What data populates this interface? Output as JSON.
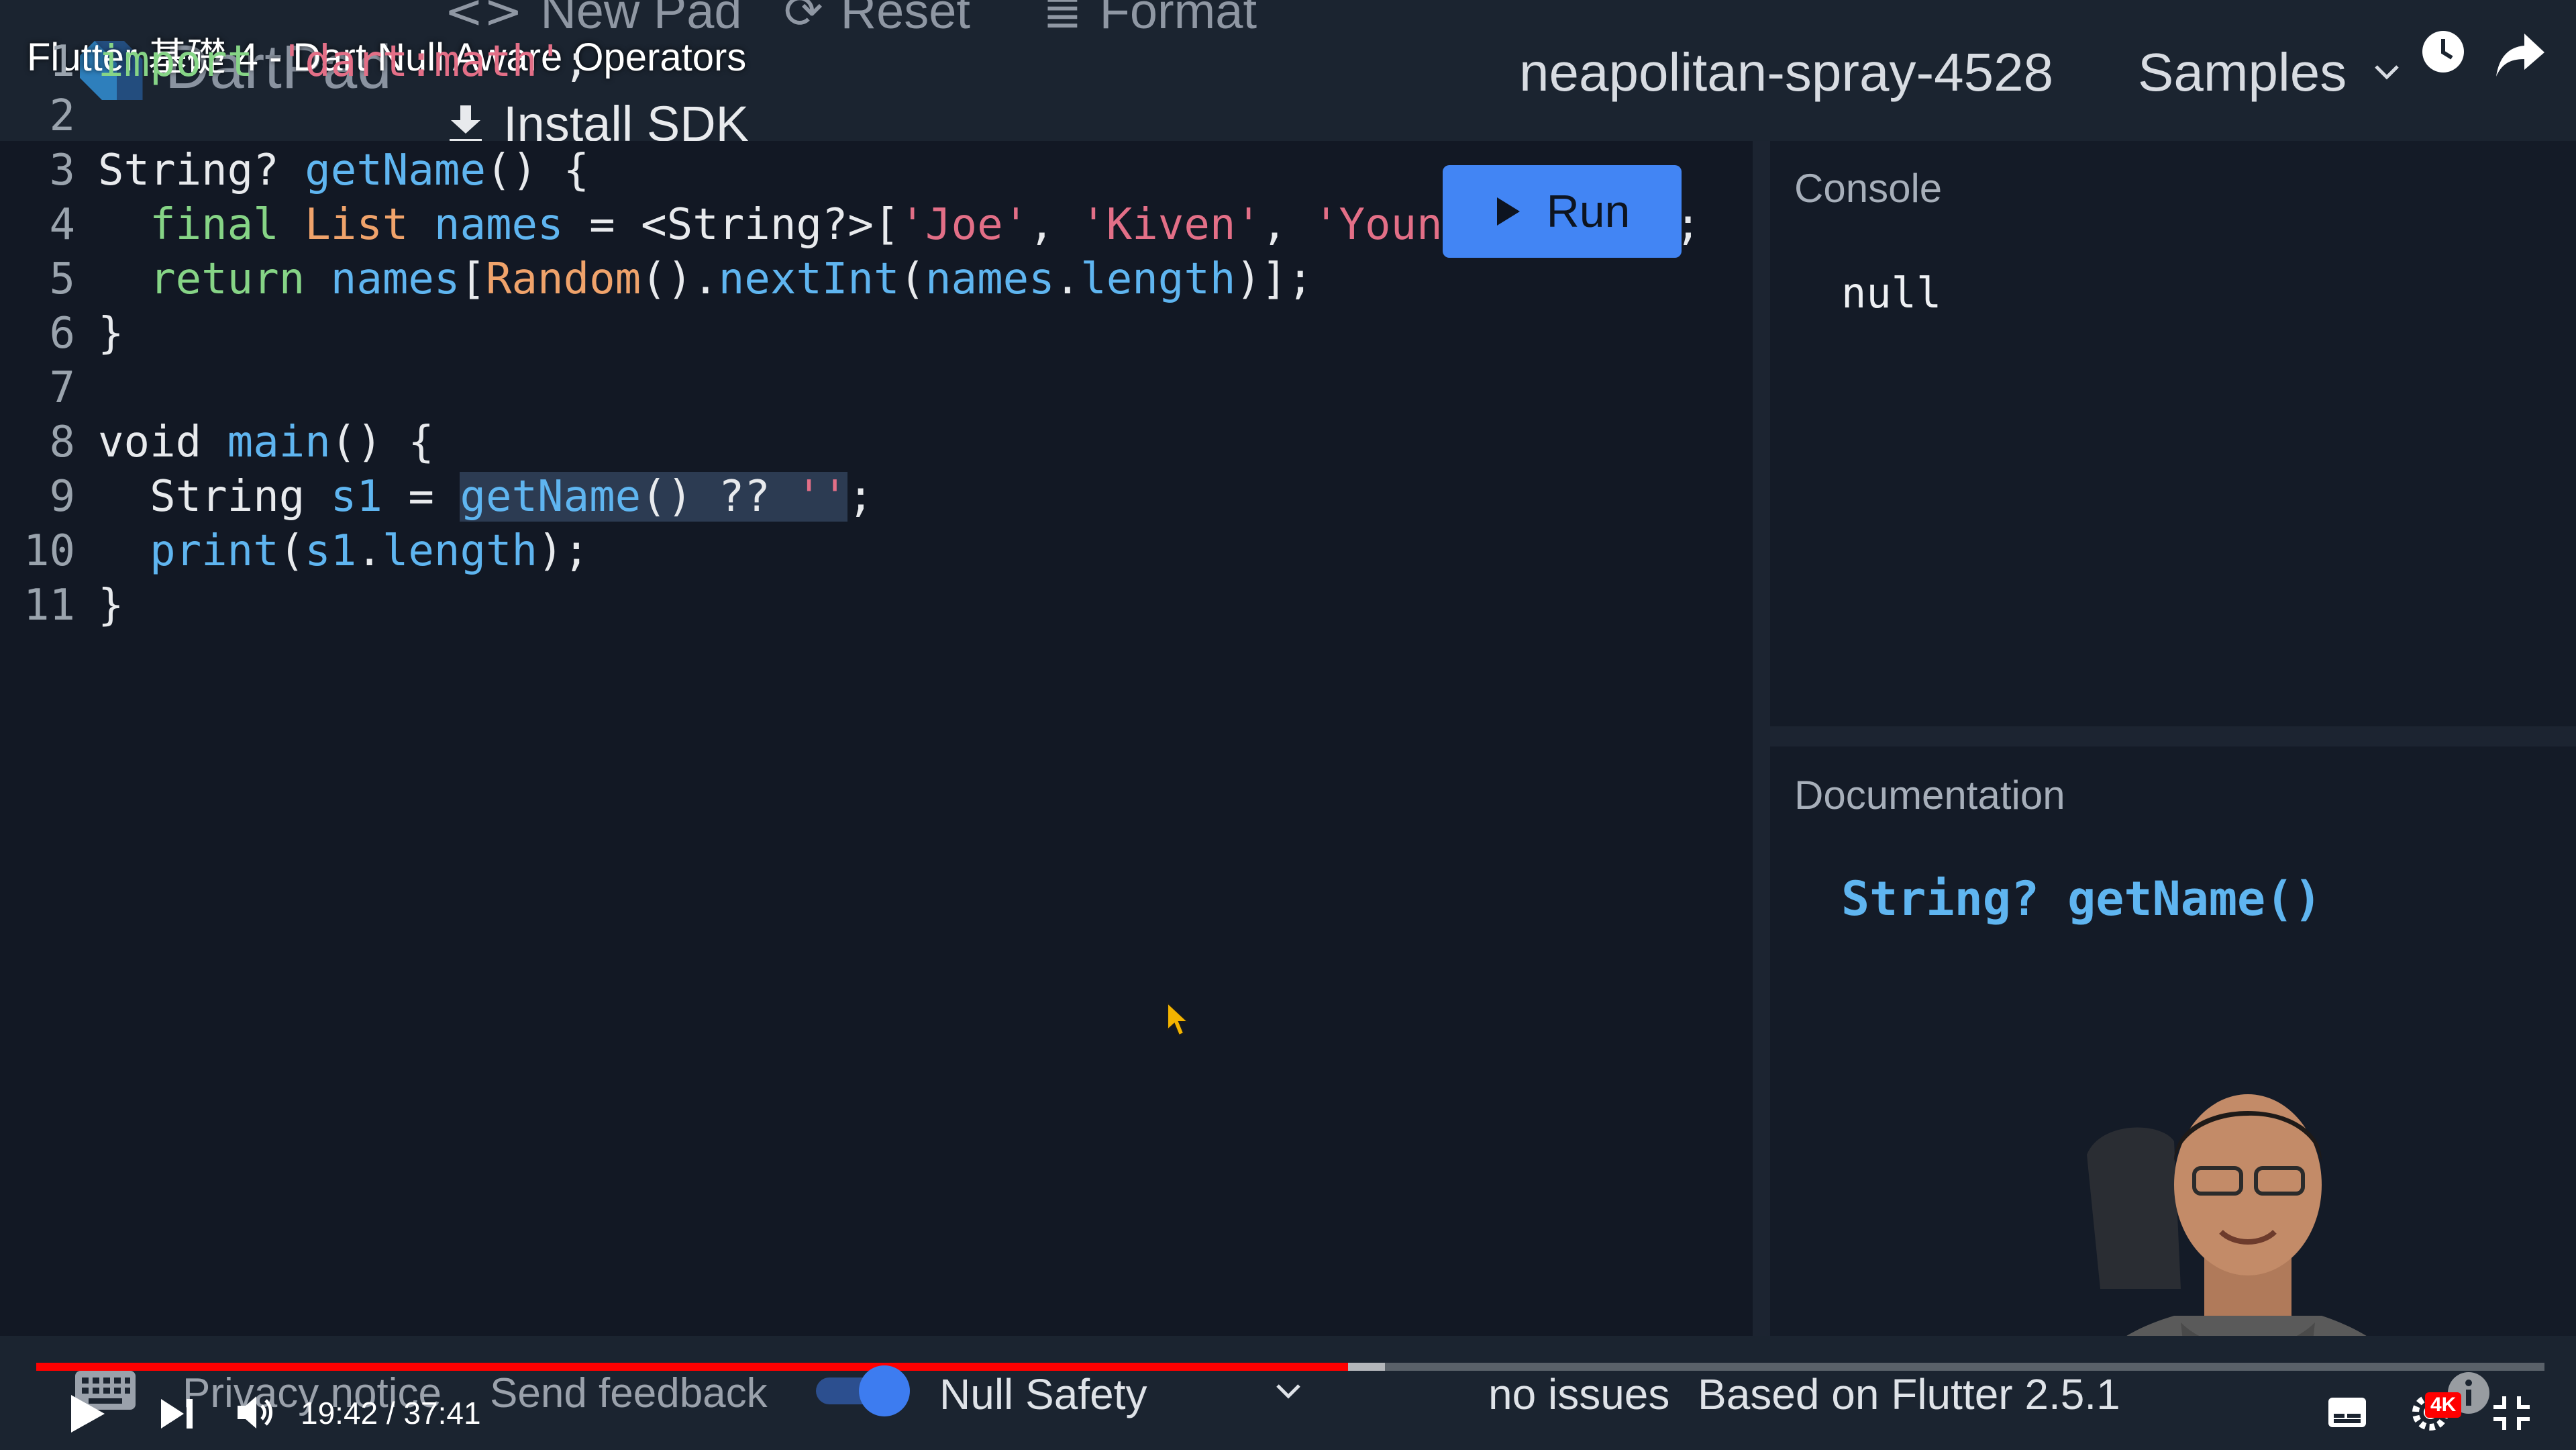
{
  "video": {
    "title": "Flutter 基礎 4 - Dart Null Aware Operators",
    "time": "19:42 / 37:41",
    "progress_fraction": 0.523,
    "quality": "4K"
  },
  "header": {
    "app_name": "DartPad",
    "new_pad": "New Pad",
    "reset": "Reset",
    "format": "Format",
    "install_sdk": "Install SDK",
    "pad_name": "neapolitan-spray-4528",
    "samples": "Samples"
  },
  "editor": {
    "run_label": "Run",
    "line_numbers": [
      "1",
      "2",
      "3",
      "4",
      "5",
      "6",
      "7",
      "8",
      "9",
      "10",
      "11"
    ],
    "lines": [
      "import 'dart:math';",
      "",
      "String? getName() {",
      "  final List names = <String?>['Joe', 'Kiven', 'Young', null];",
      "  return names[Random().nextInt(names.length)];",
      "}",
      "",
      "void main() {",
      "  String s1 = getName() ?? '';",
      "  print(s1.length);",
      "}"
    ],
    "selection": "getName() ?? ''"
  },
  "console": {
    "label": "Console",
    "output": "null"
  },
  "documentation": {
    "label": "Documentation",
    "signature": "String? getName()"
  },
  "status_bar": {
    "privacy": "Privacy notice",
    "feedback": "Send feedback",
    "null_safety": "Null Safety",
    "issues": "no issues",
    "version": "Based on Flutter 2.5.1"
  },
  "colors": {
    "accent": "#4285f4",
    "progress": "#ff0000",
    "keyword": "#86d486",
    "string": "#e36f87",
    "identifier": "#5fb5f0"
  }
}
